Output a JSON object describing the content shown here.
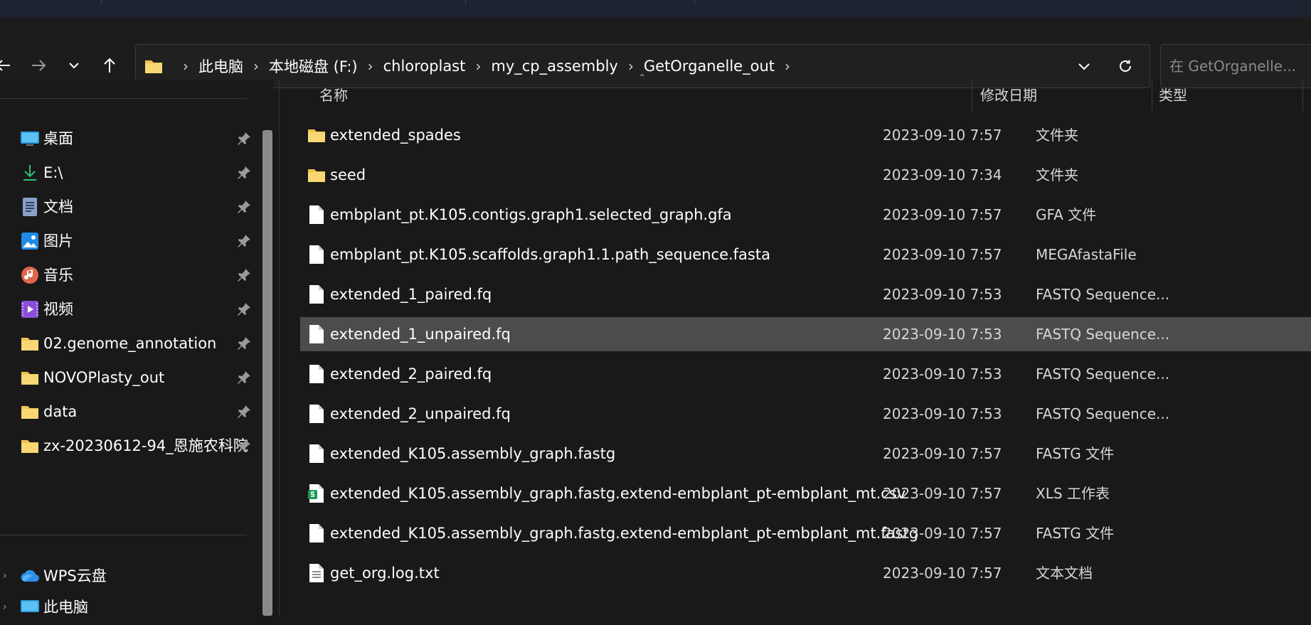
{
  "address": {
    "breadcrumbs": [
      "此电脑",
      "本地磁盘 (F:)",
      "chloroplast",
      "my_cp_assembly",
      "GetOrganelle_out"
    ]
  },
  "search": {
    "placeholder": "在 GetOrganelle..."
  },
  "sidebar": {
    "items": [
      {
        "label": "桌面",
        "icon": "desktop-icon",
        "pinned": true
      },
      {
        "label": "E:\\",
        "icon": "download-icon",
        "pinned": true
      },
      {
        "label": "文档",
        "icon": "document-icon",
        "pinned": true
      },
      {
        "label": "图片",
        "icon": "pictures-icon",
        "pinned": true
      },
      {
        "label": "音乐",
        "icon": "music-icon",
        "pinned": true
      },
      {
        "label": "视频",
        "icon": "video-icon",
        "pinned": true
      },
      {
        "label": "02.genome_annotation",
        "icon": "folder-icon",
        "pinned": true
      },
      {
        "label": "NOVOPlasty_out",
        "icon": "folder-icon",
        "pinned": true
      },
      {
        "label": "data",
        "icon": "folder-icon",
        "pinned": true
      },
      {
        "label": "zx-20230612-94_恩施农科院",
        "icon": "folder-icon",
        "pinned": true
      }
    ],
    "cloud": {
      "label": "WPS云盘",
      "icon": "cloud-icon"
    },
    "this_pc": {
      "label": "此电脑",
      "icon": "computer-icon"
    }
  },
  "columns": {
    "name": "名称",
    "modified": "修改日期",
    "type": "类型"
  },
  "files": [
    {
      "name": "extended_spades",
      "date": "2023-09-10 7:57",
      "type": "文件夹",
      "icon": "folder-icon"
    },
    {
      "name": "seed",
      "date": "2023-09-10 7:34",
      "type": "文件夹",
      "icon": "folder-icon"
    },
    {
      "name": "embplant_pt.K105.contigs.graph1.selected_graph.gfa",
      "date": "2023-09-10 7:57",
      "type": "GFA 文件",
      "icon": "file-icon"
    },
    {
      "name": "embplant_pt.K105.scaffolds.graph1.1.path_sequence.fasta",
      "date": "2023-09-10 7:57",
      "type": "MEGAfastaFile",
      "icon": "file-icon"
    },
    {
      "name": "extended_1_paired.fq",
      "date": "2023-09-10 7:53",
      "type": "FASTQ Sequence...",
      "icon": "file-icon"
    },
    {
      "name": "extended_1_unpaired.fq",
      "date": "2023-09-10 7:53",
      "type": "FASTQ Sequence...",
      "icon": "file-icon",
      "selected": true
    },
    {
      "name": "extended_2_paired.fq",
      "date": "2023-09-10 7:53",
      "type": "FASTQ Sequence...",
      "icon": "file-icon"
    },
    {
      "name": "extended_2_unpaired.fq",
      "date": "2023-09-10 7:53",
      "type": "FASTQ Sequence...",
      "icon": "file-icon"
    },
    {
      "name": "extended_K105.assembly_graph.fastg",
      "date": "2023-09-10 7:57",
      "type": "FASTG 文件",
      "icon": "file-icon"
    },
    {
      "name": "extended_K105.assembly_graph.fastg.extend-embplant_pt-embplant_mt.csv",
      "date": "2023-09-10 7:57",
      "type": "XLS 工作表",
      "icon": "spreadsheet-icon"
    },
    {
      "name": "extended_K105.assembly_graph.fastg.extend-embplant_pt-embplant_mt.fastg",
      "date": "2023-09-10 7:57",
      "type": "FASTG 文件",
      "icon": "file-icon"
    },
    {
      "name": "get_org.log.txt",
      "date": "2023-09-10 7:57",
      "type": "文本文档",
      "icon": "text-file-icon"
    }
  ],
  "colors": {
    "background": "#191919",
    "selected_row": "#4c4c4c",
    "folder": "#f2c14e",
    "accent": "#3a8dde"
  }
}
